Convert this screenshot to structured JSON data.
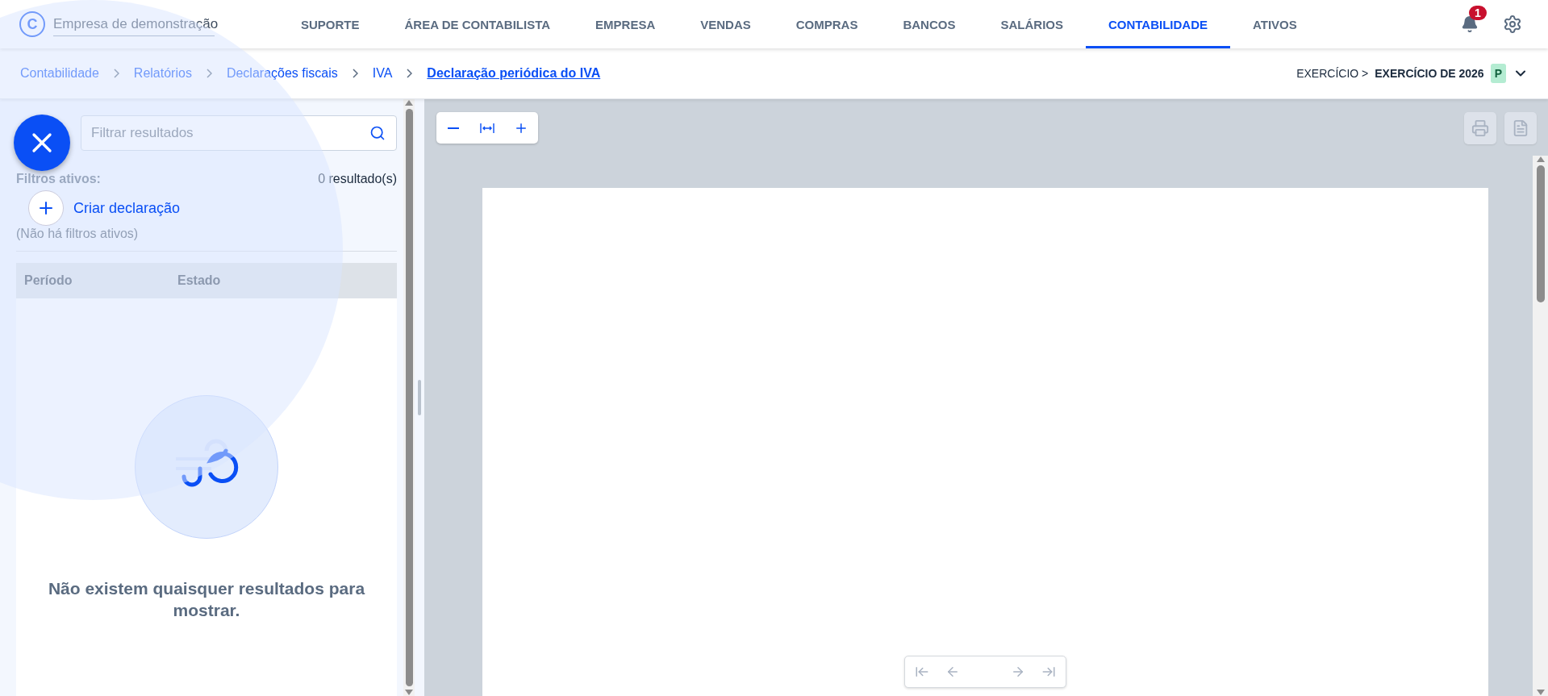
{
  "company": {
    "logo": "C",
    "name": "Empresa de demonstração"
  },
  "nav": [
    {
      "label": "SUPORTE",
      "selected": false
    },
    {
      "label": "ÁREA DE CONTABILISTA",
      "selected": false
    },
    {
      "label": "EMPRESA",
      "selected": false
    },
    {
      "label": "VENDAS",
      "selected": false
    },
    {
      "label": "COMPRAS",
      "selected": false
    },
    {
      "label": "BANCOS",
      "selected": false
    },
    {
      "label": "SALÁRIOS",
      "selected": false
    },
    {
      "label": "CONTABILIDADE",
      "selected": true
    },
    {
      "label": "ATIVOS",
      "selected": false
    }
  ],
  "notifications": {
    "count": "1"
  },
  "breadcrumb": [
    {
      "label": "Contabilidade",
      "current": false
    },
    {
      "label": "Relatórios",
      "current": false
    },
    {
      "label": "Declarações fiscais",
      "current": false
    },
    {
      "label": "IVA",
      "current": false
    },
    {
      "label": "Declaração periódica do IVA",
      "current": true
    }
  ],
  "fiscal_year": {
    "label": "EXERCÍCIO >",
    "value": "EXERCÍCIO DE 2026",
    "badge": "P"
  },
  "search": {
    "placeholder": "Filtrar resultados"
  },
  "filters": {
    "label": "Filtros ativos:",
    "value": "(Não há filtros ativos)",
    "count": "0 resultado(s)"
  },
  "table": {
    "columns": [
      "Período",
      "Estado"
    ]
  },
  "empty_message": "Não existem quaisquer resultados para mostrar.",
  "fab": {
    "expanded": true,
    "actions": [
      "Criar declaração"
    ]
  }
}
